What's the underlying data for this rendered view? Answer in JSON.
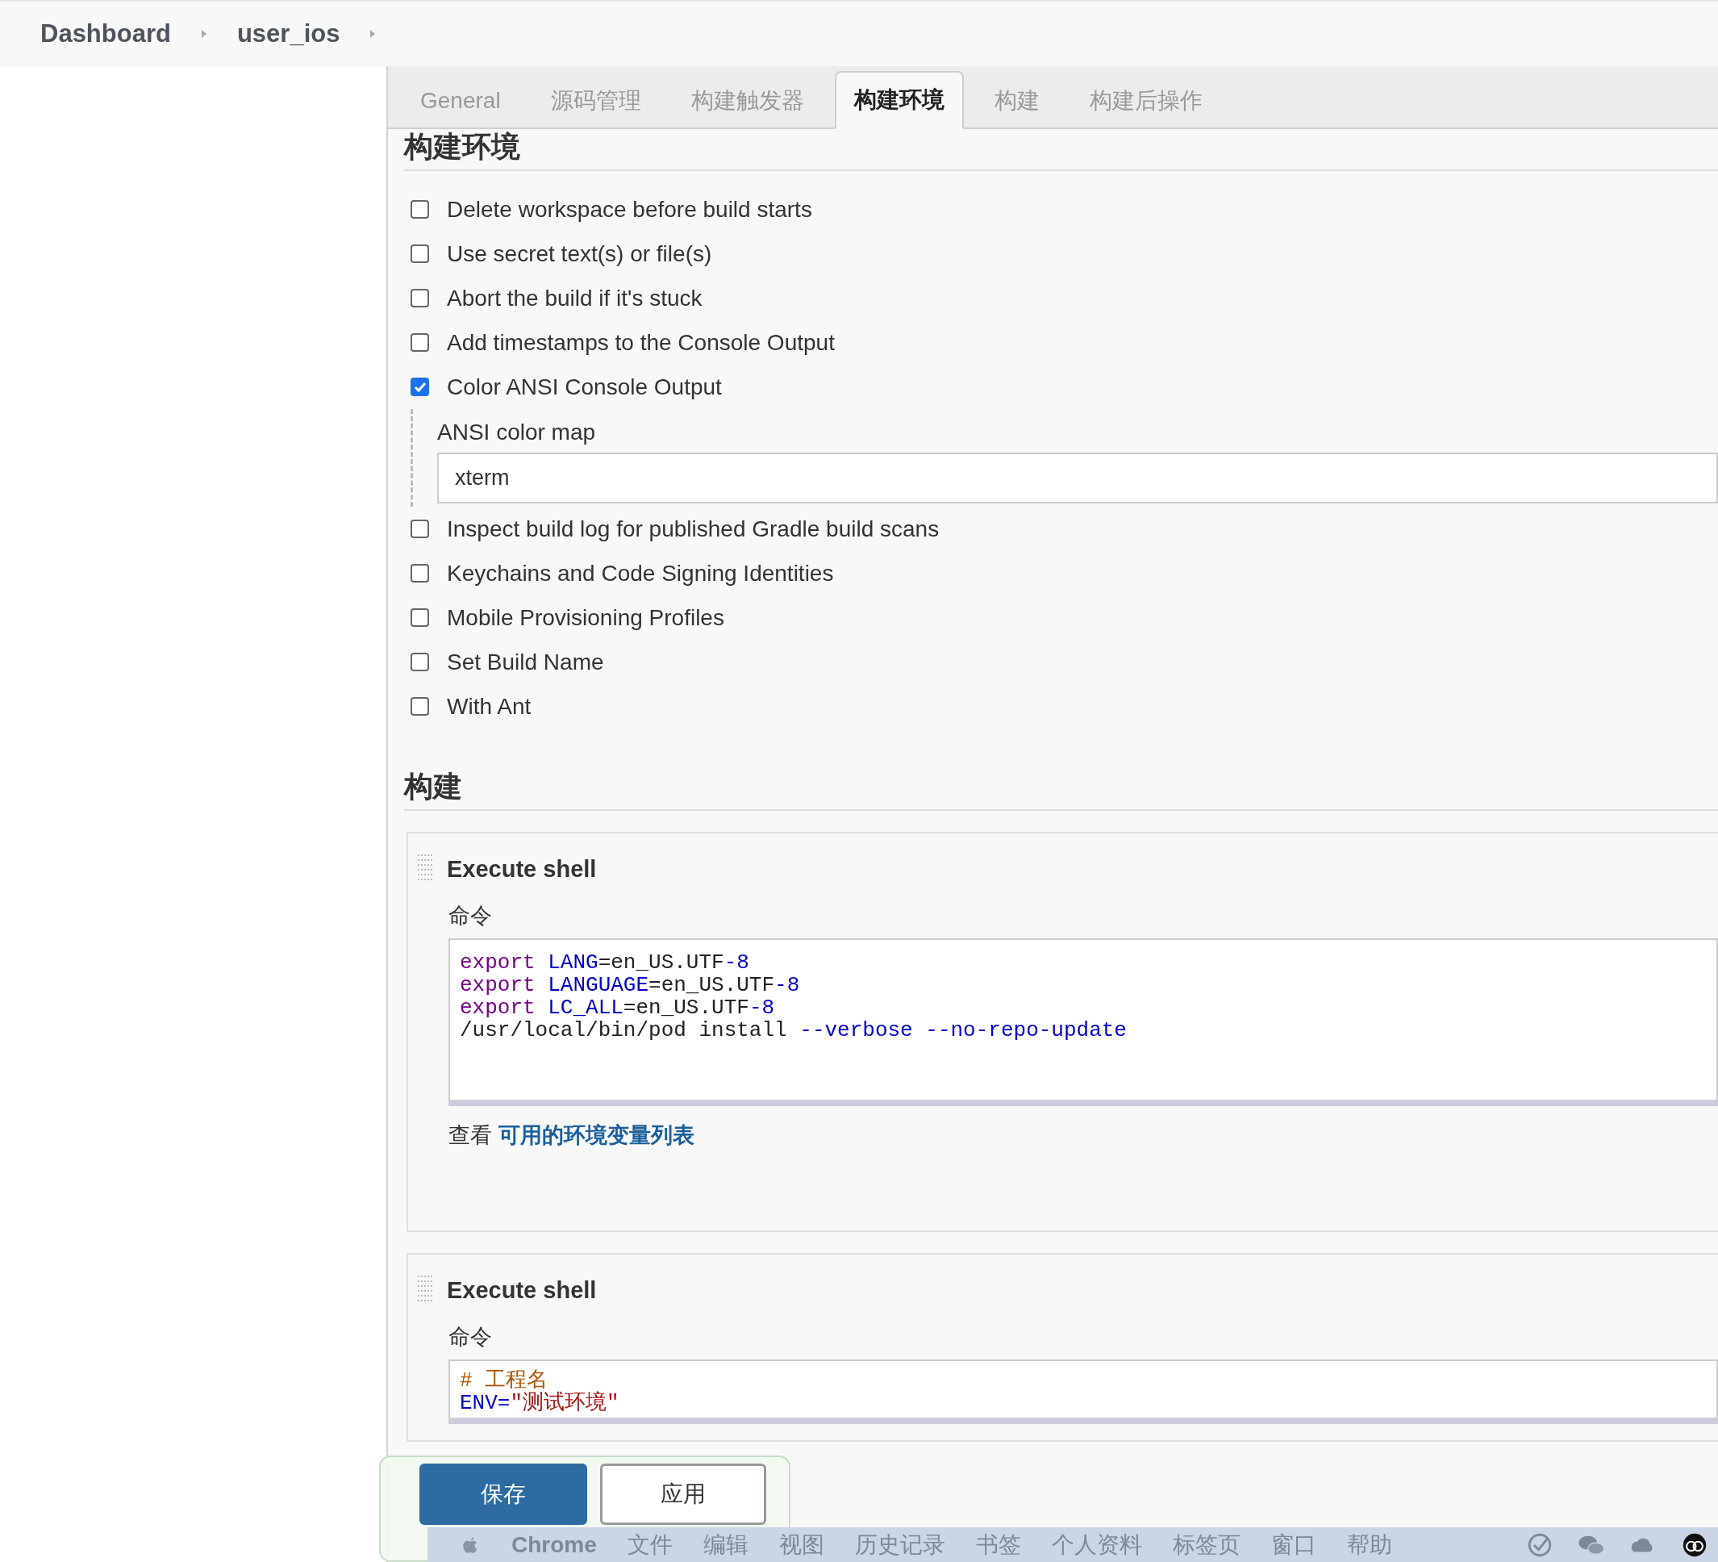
{
  "breadcrumbs": [
    "Dashboard",
    "user_ios"
  ],
  "tabs": [
    {
      "label": "General",
      "selected": false
    },
    {
      "label": "源码管理",
      "selected": false
    },
    {
      "label": "构建触发器",
      "selected": false
    },
    {
      "label": "构建环境",
      "selected": true
    },
    {
      "label": "构建",
      "selected": false
    },
    {
      "label": "构建后操作",
      "selected": false
    }
  ],
  "build_environment": {
    "title": "构建环境",
    "options": [
      {
        "label": "Delete workspace before build starts",
        "checked": false
      },
      {
        "label": "Use secret text(s) or file(s)",
        "checked": false
      },
      {
        "label": "Abort the build if it's stuck",
        "checked": false
      },
      {
        "label": "Add timestamps to the Console Output",
        "checked": false
      },
      {
        "label": "Color ANSI Console Output",
        "checked": true,
        "field": {
          "label": "ANSI color map",
          "value": "xterm"
        }
      },
      {
        "label": "Inspect build log for published Gradle build scans",
        "checked": false
      },
      {
        "label": "Keychains and Code Signing Identities",
        "checked": false
      },
      {
        "label": "Mobile Provisioning Profiles",
        "checked": false
      },
      {
        "label": "Set Build Name",
        "checked": false
      },
      {
        "label": "With Ant",
        "checked": false
      }
    ]
  },
  "build": {
    "title": "构建",
    "steps": [
      {
        "title": "Execute shell",
        "command_label": "命令",
        "code": [
          [
            {
              "kind": "keyword",
              "text": "export "
            },
            {
              "kind": "variable",
              "text": "LANG"
            },
            {
              "kind": "plain",
              "text": "=en_US.UTF"
            },
            {
              "kind": "variable",
              "text": "-8"
            }
          ],
          [
            {
              "kind": "keyword",
              "text": "export "
            },
            {
              "kind": "variable",
              "text": "LANGUAGE"
            },
            {
              "kind": "plain",
              "text": "=en_US.UTF"
            },
            {
              "kind": "variable",
              "text": "-8"
            }
          ],
          [
            {
              "kind": "keyword",
              "text": "export "
            },
            {
              "kind": "variable",
              "text": "LC_ALL"
            },
            {
              "kind": "plain",
              "text": "=en_US.UTF"
            },
            {
              "kind": "variable",
              "text": "-8"
            }
          ],
          [
            {
              "kind": "plain",
              "text": "/usr/local/bin/pod install "
            },
            {
              "kind": "variable",
              "text": "--verbose --no-repo-update"
            }
          ]
        ],
        "help_prefix": "查看",
        "help_link": "可用的环境变量列表"
      },
      {
        "title": "Execute shell",
        "command_label": "命令",
        "code": [
          [
            {
              "kind": "comment",
              "text": "# 工程名"
            }
          ],
          [
            {
              "kind": "variable",
              "text": "ENV="
            },
            {
              "kind": "string",
              "text": "\"测试环境\""
            }
          ]
        ]
      }
    ]
  },
  "actions": [
    {
      "label": "保存",
      "primary": true
    },
    {
      "label": "应用",
      "primary": false
    }
  ],
  "menu_bar": {
    "items": [
      "Chrome",
      "文件",
      "编辑",
      "视图",
      "历史记录",
      "书签",
      "个人资料",
      "标签页",
      "窗口",
      "帮助"
    ]
  }
}
